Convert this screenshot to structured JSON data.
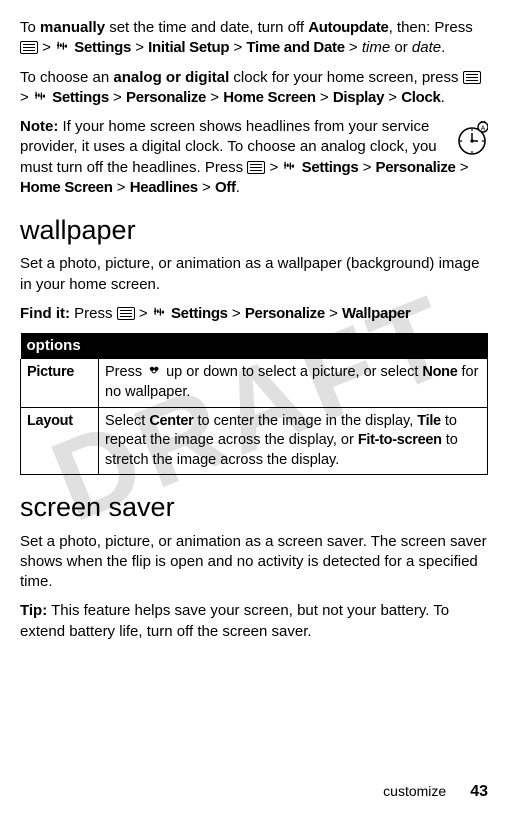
{
  "p1_a": "To ",
  "p1_bold": "manually",
  "p1_b": " set the time and date, turn off ",
  "p1_auto": "Autoupdate",
  "p1_c": ", then: Press ",
  "gt": " > ",
  "settings": "Settings",
  "p1_initial": "Initial Setup",
  "p1_timedate": "Time and Date",
  "p1_time": "time",
  "p1_or": " or ",
  "p1_date": "date",
  "p1_dot": ".",
  "p2_a": "To choose an ",
  "p2_bold": "analog or digital",
  "p2_b": " clock for your home screen, press ",
  "personalize": "Personalize",
  "homescreen": "Home Screen",
  "display": "Display",
  "clock": "Clock",
  "note_label": "Note:",
  "note_a": " If your home screen shows headlines from your service provider, it uses a digital clock. To choose an analog clock, you must turn off the headlines. Press ",
  "headlines": "Headlines",
  "off": "Off",
  "h_wallpaper": "wallpaper",
  "wp_intro": "Set a photo, picture, or animation as a wallpaper (background) image in your home screen.",
  "findit_label": "Find it:",
  "findit_a": " Press ",
  "wallpaper": "Wallpaper",
  "options_header": "options",
  "row1_label": "Picture",
  "row1_a": "Press ",
  "row1_b": " up or down to select a picture, or select ",
  "row1_none": "None",
  "row1_c": " for no wallpaper.",
  "row2_label": "Layout",
  "row2_a": "Select ",
  "row2_center": "Center",
  "row2_b": " to center the image in the display, ",
  "row2_tile": "Tile",
  "row2_c": " to repeat the image across the display, or ",
  "row2_fit": "Fit-to-screen",
  "row2_d": " to stretch the image across the display.",
  "h_screensaver": "screen saver",
  "ss_intro": "Set a photo, picture, or animation as a screen saver. The screen saver shows when the flip is open and no activity is detected for a specified time.",
  "tip_label": "Tip:",
  "tip_text": " This feature helps save your screen, but not your battery. To extend battery life, turn off the screen saver.",
  "footer_section": "customize",
  "footer_page": "43"
}
